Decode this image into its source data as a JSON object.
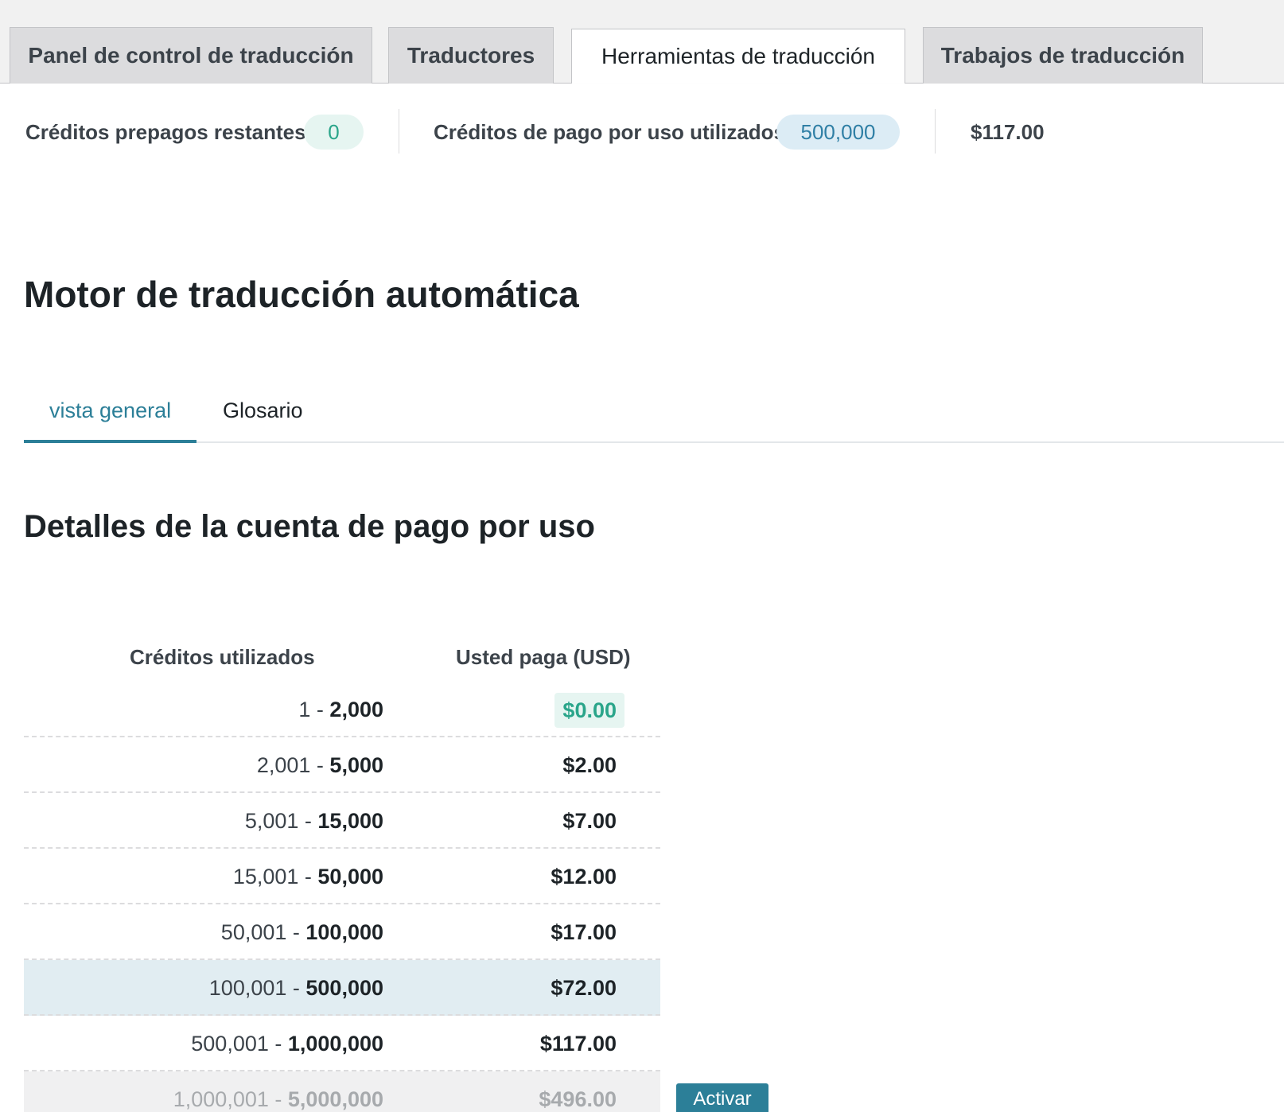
{
  "nav_tabs": [
    {
      "label": "Panel de control de traducción",
      "active": false
    },
    {
      "label": "Traductores",
      "active": false
    },
    {
      "label": "Herramientas de traducción",
      "active": true
    },
    {
      "label": "Trabajos de traducción",
      "active": false
    }
  ],
  "stats": {
    "prepaid_label": "Créditos prepagos restantes",
    "prepaid_value": "0",
    "payg_label": "Créditos de pago por uso utilizados",
    "payg_value": "500,000",
    "total_amount": "$117.00"
  },
  "page_title": "Motor de traducción automática",
  "sub_tabs": [
    {
      "label": "vista general",
      "active": true
    },
    {
      "label": "Glosario",
      "active": false
    }
  ],
  "section_title": "Detalles de la cuenta de pago por uso",
  "pricing_table": {
    "headers": [
      "Créditos utilizados",
      "Usted paga (USD)"
    ],
    "rows": [
      {
        "from": "1",
        "sep": " - ",
        "to": "2,000",
        "price": "$0.00",
        "state": "free"
      },
      {
        "from": "2,001",
        "sep": " - ",
        "to": "5,000",
        "price": "$2.00",
        "state": "normal"
      },
      {
        "from": "5,001",
        "sep": " - ",
        "to": "15,000",
        "price": "$7.00",
        "state": "normal"
      },
      {
        "from": "15,001",
        "sep": " - ",
        "to": "50,000",
        "price": "$12.00",
        "state": "normal"
      },
      {
        "from": "50,001",
        "sep": " - ",
        "to": "100,000",
        "price": "$17.00",
        "state": "normal"
      },
      {
        "from": "100,001",
        "sep": " - ",
        "to": "500,000",
        "price": "$72.00",
        "state": "current"
      },
      {
        "from": "500,001",
        "sep": " - ",
        "to": "1,000,000",
        "price": "$117.00",
        "state": "normal"
      },
      {
        "from": "1,000,001",
        "sep": " - ",
        "to": "5,000,000",
        "price": "$496.00",
        "state": "disabled"
      }
    ],
    "activate_label": "Activar"
  },
  "colors": {
    "accent": "#2c7f98",
    "success": "#2aa58a",
    "highlight_row": "#e1edf2"
  }
}
